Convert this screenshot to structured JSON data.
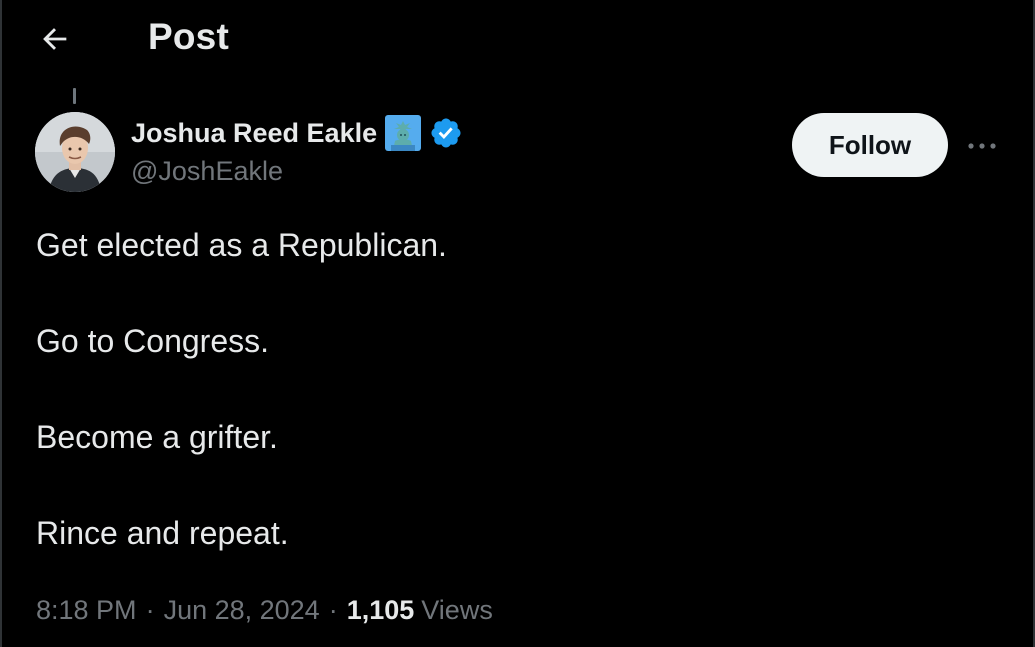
{
  "header": {
    "back_icon": "arrow-left-icon",
    "title": "Post"
  },
  "author": {
    "display_name": "Joshua Reed Eakle",
    "name_emoji_icon": "statue-of-liberty-icon",
    "verified_icon": "verified-badge-icon",
    "verified_color": "#1d9bf0",
    "handle": "@JoshEakle",
    "avatar_icon": "profile-photo-avatar"
  },
  "actions": {
    "follow_label": "Follow",
    "more_icon": "more-horizontal-icon"
  },
  "tweet": {
    "lines": [
      "Get elected as a Republican.",
      "Go to Congress.",
      "Become a grifter.",
      "Rince and repeat."
    ]
  },
  "meta": {
    "time": "8:18 PM",
    "date": "Jun 28, 2024",
    "separator": "·",
    "views_count": "1,105",
    "views_label": "Views"
  },
  "colors": {
    "background": "#000000",
    "text_primary": "#e7e9ea",
    "text_secondary": "#71767b",
    "follow_bg": "#eff3f4",
    "follow_text": "#0f1419"
  }
}
